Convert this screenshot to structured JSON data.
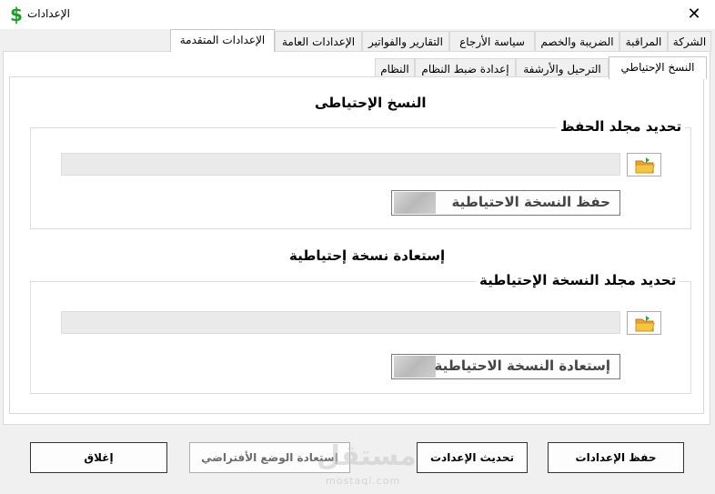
{
  "window": {
    "title": "الإعدادات",
    "close_glyph": "✕",
    "app_icon": "$"
  },
  "main_tabs": [
    {
      "label": "الشركة"
    },
    {
      "label": "المراقبة"
    },
    {
      "label": "الضريبة والخصم"
    },
    {
      "label": "سياسة الأرجاع"
    },
    {
      "label": "التقارير والفواتير"
    },
    {
      "label": "الإعدادات العامة"
    },
    {
      "label": "الإعدادات المتقدمة",
      "active": true
    }
  ],
  "sub_tabs": [
    {
      "label": "النسخ الإحتياطي",
      "active": true
    },
    {
      "label": "الترحيل والأرشفة"
    },
    {
      "label": "إعدادة ضبط النظام"
    },
    {
      "label": "النظام"
    }
  ],
  "backup": {
    "title": "النسخ الإحتياطى",
    "folder_legend": "تحديد مجلد الحفظ",
    "path_value": "",
    "save_button": "حفظ النسخة الاحتياطية"
  },
  "restore": {
    "title": "إستعادة نسخة إحتياطية",
    "folder_legend": "تحديد مجلد النسخة الإحتياطية",
    "path_value": "",
    "restore_button": "إستعادة النسخة الاحتياطية"
  },
  "footer": {
    "save_settings": "حفظ الإعدادات",
    "update_settings": "تحديث الإعدادت",
    "restore_defaults": "إستعادة الوضع الأفتراضي",
    "close": "إغلاق"
  },
  "watermark": {
    "text": "مستقل",
    "sub": "mostaql.com"
  },
  "colors": {
    "icon_green": "#1e9c2a",
    "folder_yellow": "#f5c542"
  }
}
